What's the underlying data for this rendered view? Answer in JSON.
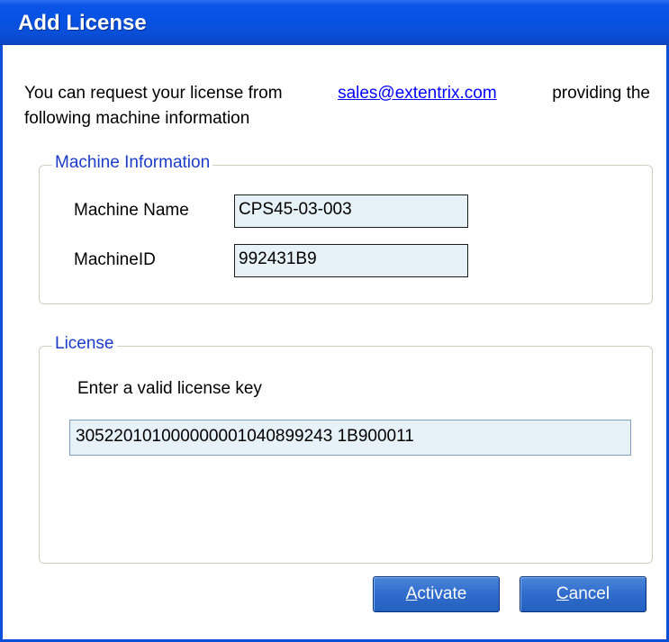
{
  "window": {
    "title": "Add License"
  },
  "intro": {
    "text_before": "You can request your license from",
    "email": "sales@extentrix.com",
    "text_after": "providing the",
    "line2": "following machine information"
  },
  "machine_info": {
    "legend": "Machine Information",
    "name_label": "Machine Name",
    "name_value": "CPS45-03-003",
    "id_label": "MachineID",
    "id_value": "992431B9"
  },
  "license": {
    "legend": "License",
    "prompt": "Enter a valid license key",
    "key_value": "305220101000000001040899243 1B900011"
  },
  "buttons": {
    "activate_first": "A",
    "activate_rest": "ctivate",
    "cancel_first": "C",
    "cancel_rest": "ancel"
  }
}
